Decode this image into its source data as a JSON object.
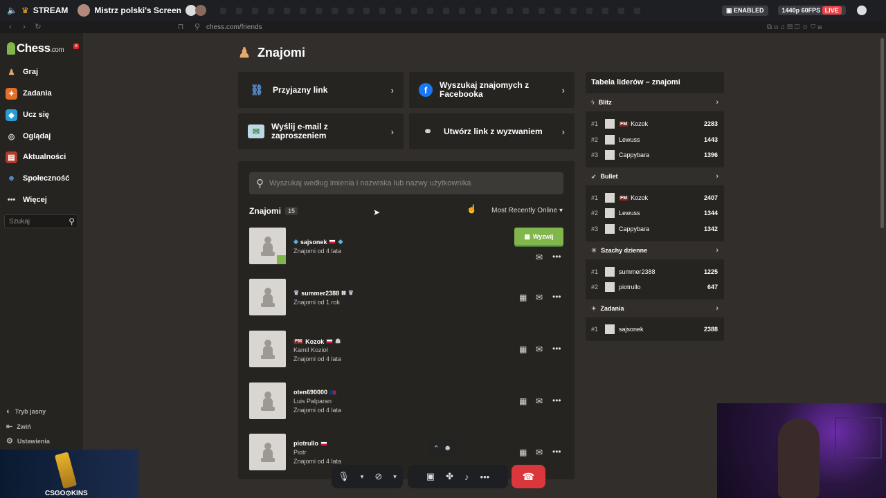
{
  "stream": {
    "label": "STREAM",
    "screen_title": "Mistrz polski's Screen",
    "enabled_badge": "ENABLED",
    "quality": "1440p 60FPS",
    "live": "LIVE"
  },
  "browser": {
    "url": "chess.com/friends"
  },
  "sidebar": {
    "logo": "Chess",
    "logo_suffix": ".com",
    "items": [
      {
        "label": "Graj",
        "icon": "play-pawn-icon",
        "color": "#c86e2b"
      },
      {
        "label": "Zadania",
        "icon": "puzzle-icon",
        "color": "#e0702c"
      },
      {
        "label": "Ucz się",
        "icon": "learn-cap-icon",
        "color": "#2a9bd1"
      },
      {
        "label": "Oglądaj",
        "icon": "binoculars-icon",
        "color": "#cfcfcf"
      },
      {
        "label": "Aktualności",
        "icon": "news-icon",
        "color": "#b33b2a"
      },
      {
        "label": "Społeczność",
        "icon": "community-icon",
        "color": "#5b8fd0"
      },
      {
        "label": "Więcej",
        "icon": "more-dots-icon",
        "color": "#cfcfcf"
      }
    ],
    "search_placeholder": "Szukaj",
    "footer": [
      {
        "label": "Tryb jasny",
        "icon": "theme-icon"
      },
      {
        "label": "Zwiń",
        "icon": "collapse-icon"
      },
      {
        "label": "Ustawienia",
        "icon": "settings-gear-icon"
      }
    ]
  },
  "page": {
    "title": "Znajomi",
    "cards": [
      {
        "label": "Przyjazny link",
        "icon": "friendly-link-icon"
      },
      {
        "label": "Wyszukaj znajomych z Facebooka",
        "icon": "facebook-icon"
      },
      {
        "label": "Wyślij e-mail z zaproszeniem",
        "icon": "email-invite-icon"
      },
      {
        "label": "Utwórz link z wyzwaniem",
        "icon": "challenge-link-icon"
      }
    ],
    "search_placeholder": "Wyszukaj według imienia i nazwiska lub nazwy użytkownika",
    "friends_label": "Znajomi",
    "friends_count": "15",
    "sort_label": "Most Recently Online",
    "challenge_label": "Wyzwij",
    "friends": [
      {
        "username": "sajsonek",
        "realname": "",
        "since": "Znajomi od 4 lata",
        "online": true,
        "fm": false,
        "flag": "pl"
      },
      {
        "username": "summer2388",
        "realname": "",
        "since": "Znajomi od 1 rok",
        "online": false,
        "fm": false,
        "flag": ""
      },
      {
        "username": "Kozok",
        "realname": "Kamil Kozioł",
        "since": "Znajomi od 4 lata",
        "online": false,
        "fm": true,
        "flag": "pl"
      },
      {
        "username": "oten690000",
        "realname": "Luis Palparan",
        "since": "Znajomi od 4 lata",
        "online": false,
        "fm": false,
        "flag": "ph"
      },
      {
        "username": "piotrullo",
        "realname": "Piotr",
        "since": "Znajomi od 4 lata",
        "online": false,
        "fm": false,
        "flag": "pl"
      }
    ]
  },
  "leaderboard": {
    "title": "Tabela liderów – znajomi",
    "fm_badge": "FM",
    "sections": [
      {
        "name": "Blitz",
        "icon": "blitz-icon",
        "rows": [
          {
            "rank": "#1",
            "name": "Kozok",
            "fm": true,
            "score": "2283"
          },
          {
            "rank": "#2",
            "name": "Lewuss",
            "fm": false,
            "score": "1443"
          },
          {
            "rank": "#3",
            "name": "Cappybara",
            "fm": false,
            "score": "1396"
          }
        ]
      },
      {
        "name": "Bullet",
        "icon": "bullet-icon",
        "rows": [
          {
            "rank": "#1",
            "name": "Kozok",
            "fm": true,
            "score": "2407"
          },
          {
            "rank": "#2",
            "name": "Lewuss",
            "fm": false,
            "score": "1344"
          },
          {
            "rank": "#3",
            "name": "Cappybara",
            "fm": false,
            "score": "1342"
          }
        ]
      },
      {
        "name": "Szachy dzienne",
        "icon": "daily-sun-icon",
        "rows": [
          {
            "rank": "#1",
            "name": "summer2388",
            "fm": false,
            "score": "1225"
          },
          {
            "rank": "#2",
            "name": "piotrullo",
            "fm": false,
            "score": "647"
          }
        ]
      },
      {
        "name": "Zadania",
        "icon": "puzzle-icon",
        "rows": [
          {
            "rank": "#1",
            "name": "sajsonek",
            "fm": false,
            "score": "2388"
          }
        ]
      }
    ]
  },
  "overlay": {
    "csgo_text": "CSGO⊙KINS"
  }
}
